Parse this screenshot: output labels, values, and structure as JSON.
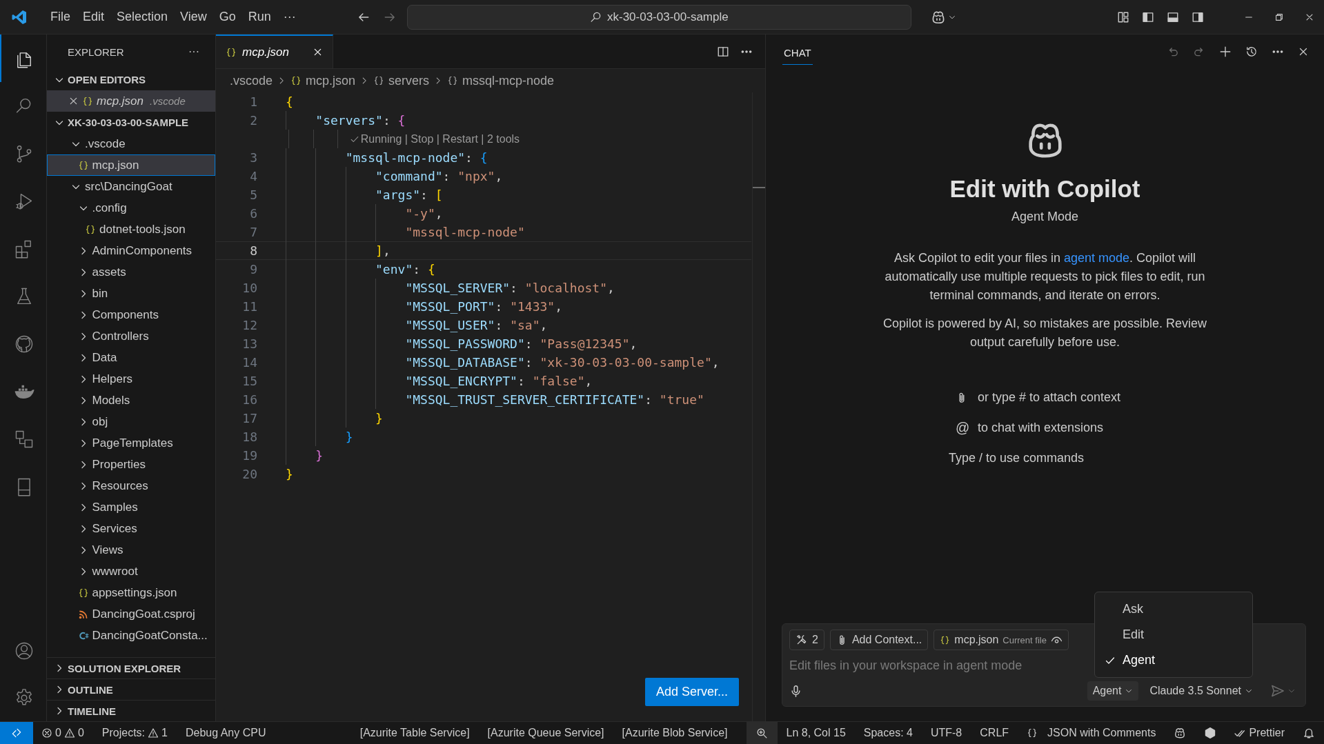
{
  "title_bar": {
    "menu": [
      "File",
      "Edit",
      "Selection",
      "View",
      "Go",
      "Run"
    ],
    "more": "···",
    "search": "xk-30-03-03-00-sample"
  },
  "activity_bar": {
    "top": [
      {
        "kind": "files",
        "selected": true
      },
      {
        "kind": "search",
        "selected": false
      },
      {
        "kind": "source-control",
        "selected": false
      },
      {
        "kind": "run-debug",
        "selected": false
      },
      {
        "kind": "extensions",
        "selected": false
      },
      {
        "kind": "testing",
        "selected": false
      },
      {
        "kind": "github",
        "selected": false
      },
      {
        "kind": "docker",
        "selected": false
      },
      {
        "kind": "remote",
        "selected": false
      },
      {
        "kind": "tablet",
        "selected": false
      }
    ],
    "bottom": [
      {
        "kind": "account",
        "selected": false
      },
      {
        "kind": "settings",
        "selected": false
      }
    ]
  },
  "sidebar": {
    "title": "EXPLORER",
    "more": "···",
    "open_editors": {
      "label": "OPEN EDITORS",
      "expanded": true,
      "items": [
        {
          "name": "mcp.json",
          "description": ".vscode",
          "kind": "json",
          "selected": true
        }
      ]
    },
    "folder": {
      "label": "XK-30-03-03-00-SAMPLE",
      "expanded": true,
      "children": [
        {
          "name": ".vscode",
          "kind": "folder",
          "expanded": true,
          "selected": false,
          "children": [
            {
              "name": "mcp.json",
              "kind": "json",
              "selected": true
            }
          ]
        },
        {
          "name": "src\\DancingGoat",
          "kind": "folder",
          "expanded": true,
          "selected": false,
          "children": [
            {
              "name": ".config",
              "kind": "folder",
              "expanded": true,
              "selected": false,
              "children": [
                {
                  "name": "dotnet-tools.json",
                  "kind": "json",
                  "selected": false
                }
              ]
            },
            {
              "name": "AdminComponents",
              "kind": "folder",
              "expanded": false,
              "selected": false
            },
            {
              "name": "assets",
              "kind": "folder",
              "expanded": false,
              "selected": false
            },
            {
              "name": "bin",
              "kind": "folder",
              "expanded": false,
              "selected": false
            },
            {
              "name": "Components",
              "kind": "folder",
              "expanded": false,
              "selected": false
            },
            {
              "name": "Controllers",
              "kind": "folder",
              "expanded": false,
              "selected": false
            },
            {
              "name": "Data",
              "kind": "folder",
              "expanded": false,
              "selected": false
            },
            {
              "name": "Helpers",
              "kind": "folder",
              "expanded": false,
              "selected": false
            },
            {
              "name": "Models",
              "kind": "folder",
              "expanded": false,
              "selected": false
            },
            {
              "name": "obj",
              "kind": "folder",
              "expanded": false,
              "selected": false
            },
            {
              "name": "PageTemplates",
              "kind": "folder",
              "expanded": false,
              "selected": false
            },
            {
              "name": "Properties",
              "kind": "folder",
              "expanded": false,
              "selected": false
            },
            {
              "name": "Resources",
              "kind": "folder",
              "expanded": false,
              "selected": false
            },
            {
              "name": "Samples",
              "kind": "folder",
              "expanded": false,
              "selected": false
            },
            {
              "name": "Services",
              "kind": "folder",
              "expanded": false,
              "selected": false
            },
            {
              "name": "Views",
              "kind": "folder",
              "expanded": false,
              "selected": false
            },
            {
              "name": "wwwroot",
              "kind": "folder",
              "expanded": false,
              "selected": false
            },
            {
              "name": "appsettings.json",
              "kind": "json",
              "selected": false
            },
            {
              "name": "DancingGoat.csproj",
              "kind": "project",
              "selected": false
            },
            {
              "name": "DancingGoatConsta...",
              "kind": "csharp",
              "selected": false
            }
          ]
        }
      ]
    },
    "sections": [
      {
        "label": "SOLUTION EXPLORER",
        "expanded": false
      },
      {
        "label": "OUTLINE",
        "expanded": false
      },
      {
        "label": "TIMELINE",
        "expanded": false
      }
    ]
  },
  "editor": {
    "tabs": [
      {
        "label": "mcp.json",
        "kind": "json",
        "preview": true,
        "selected": true
      }
    ],
    "breadcrumb": [
      {
        "label": ".vscode",
        "kind": "folder"
      },
      {
        "label": "mcp.json",
        "kind": "json"
      },
      {
        "label": "servers",
        "kind": "object"
      },
      {
        "label": "mssql-mcp-node",
        "kind": "object"
      }
    ],
    "lines": [
      {
        "kind": "code",
        "number": "1",
        "current": false,
        "tokens": [
          {
            "t": "{",
            "kind": "b1"
          }
        ]
      },
      {
        "kind": "code",
        "number": "2",
        "current": false,
        "tokens": [
          {
            "t": "    \"servers\"",
            "kind": "key"
          },
          {
            "t": ": ",
            "kind": "punct"
          },
          {
            "t": "{",
            "kind": "b2"
          }
        ]
      },
      {
        "kind": "codelens",
        "text": "Running | Stop | Restart | 2 tools"
      },
      {
        "kind": "code",
        "number": "3",
        "current": false,
        "tokens": [
          {
            "t": "        \"mssql-mcp-node\"",
            "kind": "key"
          },
          {
            "t": ": ",
            "kind": "punct"
          },
          {
            "t": "{",
            "kind": "b3"
          }
        ]
      },
      {
        "kind": "code",
        "number": "4",
        "current": false,
        "tokens": [
          {
            "t": "            \"command\"",
            "kind": "key"
          },
          {
            "t": ": ",
            "kind": "punct"
          },
          {
            "t": "\"npx\"",
            "kind": "str"
          },
          {
            "t": ",",
            "kind": "punct"
          }
        ]
      },
      {
        "kind": "code",
        "number": "5",
        "current": false,
        "tokens": [
          {
            "t": "            \"args\"",
            "kind": "key"
          },
          {
            "t": ": ",
            "kind": "punct"
          },
          {
            "t": "[",
            "kind": "b1"
          }
        ]
      },
      {
        "kind": "code",
        "number": "6",
        "current": false,
        "tokens": [
          {
            "t": "                \"-y\"",
            "kind": "str"
          },
          {
            "t": ",",
            "kind": "punct"
          }
        ]
      },
      {
        "kind": "code",
        "number": "7",
        "current": false,
        "tokens": [
          {
            "t": "                \"mssql-mcp-node\"",
            "kind": "str"
          }
        ]
      },
      {
        "kind": "code",
        "number": "8",
        "current": true,
        "tokens": [
          {
            "t": "            ]",
            "kind": "b1"
          },
          {
            "t": ",",
            "kind": "punct"
          }
        ]
      },
      {
        "kind": "code",
        "number": "9",
        "current": false,
        "tokens": [
          {
            "t": "            \"env\"",
            "kind": "key"
          },
          {
            "t": ": ",
            "kind": "punct"
          },
          {
            "t": "{",
            "kind": "b1"
          }
        ]
      },
      {
        "kind": "code",
        "number": "10",
        "current": false,
        "tokens": [
          {
            "t": "                \"MSSQL_SERVER\"",
            "kind": "key"
          },
          {
            "t": ": ",
            "kind": "punct"
          },
          {
            "t": "\"localhost\"",
            "kind": "str"
          },
          {
            "t": ",",
            "kind": "punct"
          }
        ]
      },
      {
        "kind": "code",
        "number": "11",
        "current": false,
        "tokens": [
          {
            "t": "                \"MSSQL_PORT\"",
            "kind": "key"
          },
          {
            "t": ": ",
            "kind": "punct"
          },
          {
            "t": "\"1433\"",
            "kind": "str"
          },
          {
            "t": ",",
            "kind": "punct"
          }
        ]
      },
      {
        "kind": "code",
        "number": "12",
        "current": false,
        "tokens": [
          {
            "t": "                \"MSSQL_USER\"",
            "kind": "key"
          },
          {
            "t": ": ",
            "kind": "punct"
          },
          {
            "t": "\"sa\"",
            "kind": "str"
          },
          {
            "t": ",",
            "kind": "punct"
          }
        ]
      },
      {
        "kind": "code",
        "number": "13",
        "current": false,
        "tokens": [
          {
            "t": "                \"MSSQL_PASSWORD\"",
            "kind": "key"
          },
          {
            "t": ": ",
            "kind": "punct"
          },
          {
            "t": "\"Pass@12345\"",
            "kind": "str"
          },
          {
            "t": ",",
            "kind": "punct"
          }
        ]
      },
      {
        "kind": "code",
        "number": "14",
        "current": false,
        "tokens": [
          {
            "t": "                \"MSSQL_DATABASE\"",
            "kind": "key"
          },
          {
            "t": ": ",
            "kind": "punct"
          },
          {
            "t": "\"xk-30-03-03-00-sample\"",
            "kind": "str"
          },
          {
            "t": ",",
            "kind": "punct"
          }
        ]
      },
      {
        "kind": "code",
        "number": "15",
        "current": false,
        "tokens": [
          {
            "t": "                \"MSSQL_ENCRYPT\"",
            "kind": "key"
          },
          {
            "t": ": ",
            "kind": "punct"
          },
          {
            "t": "\"false\"",
            "kind": "str"
          },
          {
            "t": ",",
            "kind": "punct"
          }
        ]
      },
      {
        "kind": "code",
        "number": "16",
        "current": false,
        "tokens": [
          {
            "t": "                \"MSSQL_TRUST_SERVER_CERTIFICATE\"",
            "kind": "key"
          },
          {
            "t": ": ",
            "kind": "punct"
          },
          {
            "t": "\"true\"",
            "kind": "str"
          }
        ]
      },
      {
        "kind": "code",
        "number": "17",
        "current": false,
        "tokens": [
          {
            "t": "            }",
            "kind": "b1"
          }
        ]
      },
      {
        "kind": "code",
        "number": "18",
        "current": false,
        "tokens": [
          {
            "t": "        }",
            "kind": "b3"
          }
        ]
      },
      {
        "kind": "code",
        "number": "19",
        "current": false,
        "tokens": [
          {
            "t": "    }",
            "kind": "b2"
          }
        ]
      },
      {
        "kind": "code",
        "number": "20",
        "current": false,
        "tokens": [
          {
            "t": "}",
            "kind": "b1"
          }
        ]
      }
    ],
    "add_server_button": "Add Server..."
  },
  "chat": {
    "tab": "CHAT",
    "title": "Edit with Copilot",
    "subtitle": "Agent Mode",
    "intro": {
      "before": "Ask Copilot to edit your files in ",
      "link": "agent mode",
      "after": ". Copilot will automatically use multiple requests to pick files to edit, run terminal commands, and iterate on errors."
    },
    "disclaimer": "Copilot is powered by AI, so mistakes are possible. Review output carefully before use.",
    "hints": [
      {
        "kind": "attach",
        "text": "or type # to attach context"
      },
      {
        "kind": "mention",
        "symbol": "@",
        "text": "to chat with extensions"
      },
      {
        "kind": "plain",
        "text": "Type / to use commands"
      }
    ],
    "input": {
      "tools_count": "2",
      "add_context": "Add Context...",
      "file": {
        "name": "mcp.json",
        "note": "Current file"
      },
      "placeholder": "Edit files in your workspace in agent mode",
      "mode": "Agent",
      "model": "Claude 3.5 Sonnet"
    },
    "mode_menu": [
      {
        "label": "Ask",
        "selected": false
      },
      {
        "label": "Edit",
        "selected": false
      },
      {
        "label": "Agent",
        "selected": true
      }
    ]
  },
  "status_bar": {
    "left": [
      {
        "kind": "remote"
      },
      {
        "kind": "problems",
        "errors": "0",
        "warnings": "0"
      },
      {
        "kind": "projects",
        "label": "Projects:",
        "count": "1"
      },
      {
        "kind": "text",
        "text": "Debug Any CPU"
      }
    ],
    "middle": [
      {
        "kind": "text",
        "text": "[Azurite Table Service]"
      },
      {
        "kind": "text",
        "text": "[Azurite Queue Service]"
      },
      {
        "kind": "text",
        "text": "[Azurite Blob Service]"
      }
    ],
    "right": [
      {
        "kind": "zoom"
      },
      {
        "kind": "text",
        "text": "Ln 8, Col 15"
      },
      {
        "kind": "text",
        "text": "Spaces: 4"
      },
      {
        "kind": "text",
        "text": "UTF-8"
      },
      {
        "kind": "text",
        "text": "CRLF"
      },
      {
        "kind": "language",
        "text": "JSON with Comments"
      },
      {
        "kind": "copilot"
      },
      {
        "kind": "csharp"
      },
      {
        "kind": "prettier",
        "text": "Prettier"
      },
      {
        "kind": "bell"
      }
    ]
  }
}
